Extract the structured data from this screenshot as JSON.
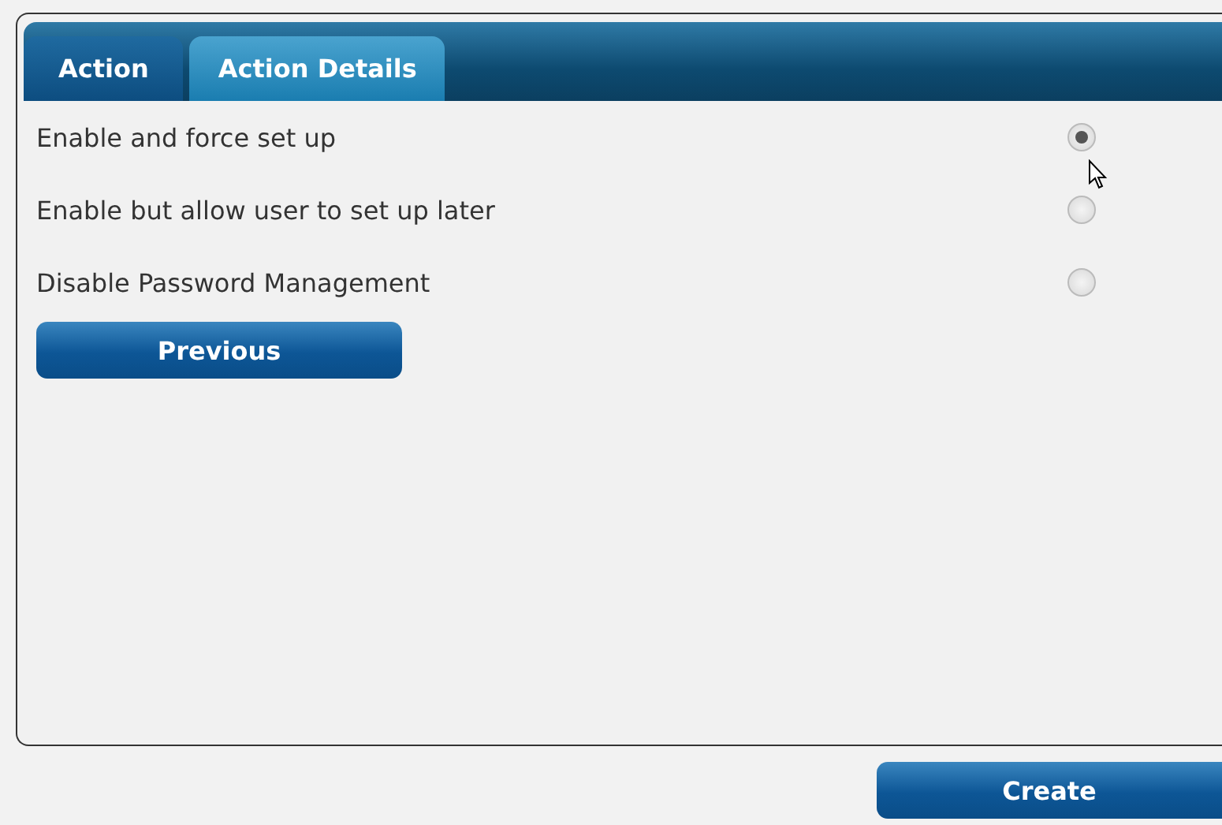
{
  "tabs": [
    {
      "label": "Action",
      "selected": false
    },
    {
      "label": "Action Details",
      "selected": true
    }
  ],
  "options": [
    {
      "label": "Enable and force set up",
      "selected": true
    },
    {
      "label": "Enable but allow user to set up later",
      "selected": false
    },
    {
      "label": "Disable Password Management",
      "selected": false
    }
  ],
  "previous_button": "Previous",
  "create_button": "Create"
}
